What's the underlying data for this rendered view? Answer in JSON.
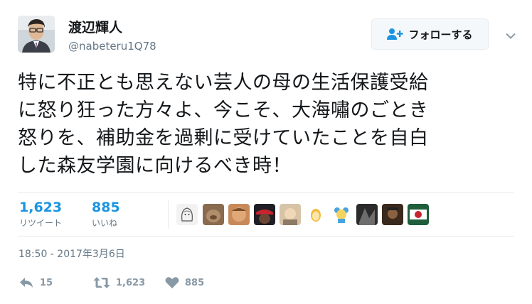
{
  "author": {
    "display_name": "渡辺輝人",
    "username": "@nabeteru1Q78"
  },
  "follow_button": {
    "label": "フォローする",
    "icon": "add-user-icon"
  },
  "menu": {
    "icon": "chevron-down-icon"
  },
  "tweet": {
    "text": "特に不正とも思えない芸人の母の生活保護受給\nに怒り狂った方々よ、今こそ、大海嘯のごとき\n怒りを、補助金を過剰に受けていたことを自白\nした森友学園に向けるべき時！"
  },
  "stats": {
    "retweets": {
      "count": "1,623",
      "label": "リツイート"
    },
    "likes": {
      "count": "885",
      "label": "いいね"
    }
  },
  "likers_count_shown": 9,
  "timestamp": "18:50 - 2017年3月6日",
  "actions": {
    "reply": {
      "count": "15",
      "icon": "reply-icon"
    },
    "retweet": {
      "count": "1,623",
      "icon": "retweet-icon"
    },
    "like": {
      "count": "885",
      "icon": "heart-icon"
    }
  },
  "colors": {
    "link_blue": "#1b95e0",
    "secondary_text": "#657786",
    "action_gray": "#8899a6",
    "border": "#e6ecf0"
  }
}
